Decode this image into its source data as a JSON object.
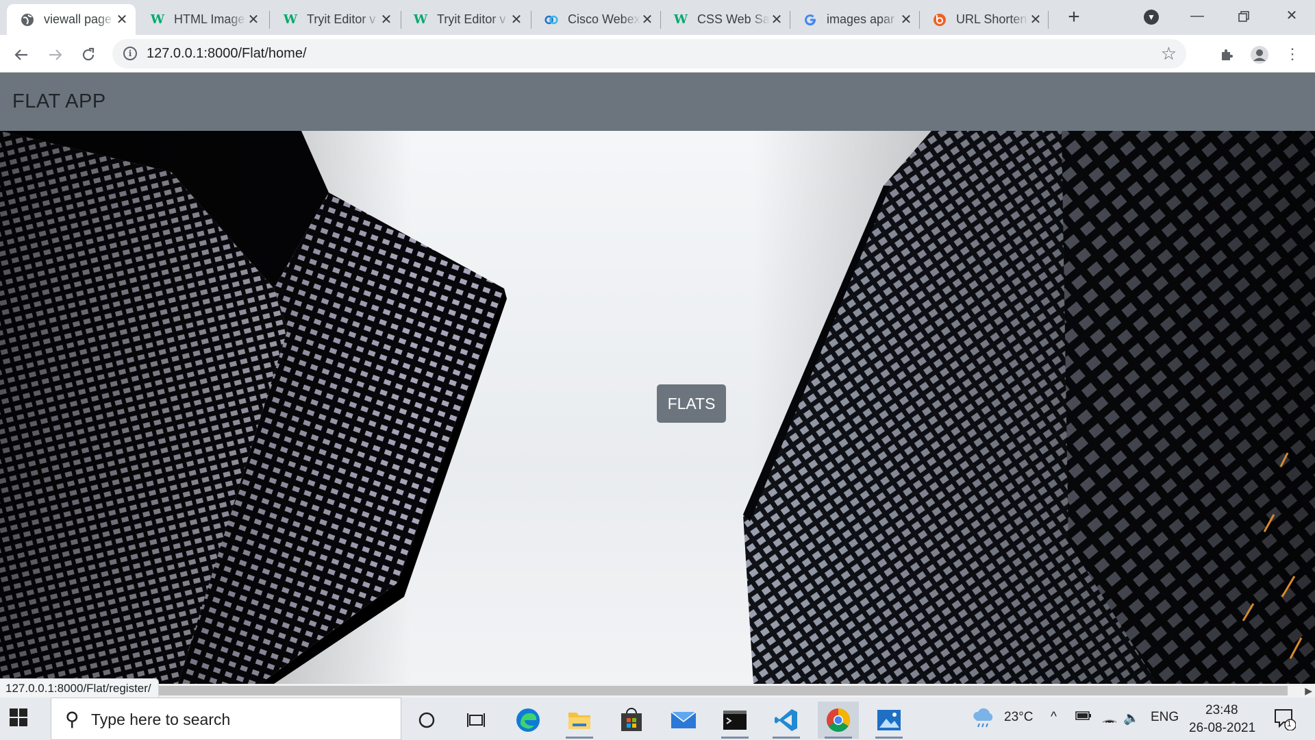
{
  "browser": {
    "tabs": [
      {
        "title": "viewall page",
        "icon": "globe-icon",
        "active": true
      },
      {
        "title": "HTML Image",
        "icon": "w3schools-icon",
        "active": false
      },
      {
        "title": "Tryit Editor v",
        "icon": "w3schools-icon",
        "active": false
      },
      {
        "title": "Tryit Editor v",
        "icon": "w3schools-icon",
        "active": false
      },
      {
        "title": "Cisco Webex",
        "icon": "webex-icon",
        "active": false
      },
      {
        "title": "CSS Web Sa",
        "icon": "w3schools-icon",
        "active": false
      },
      {
        "title": "images apar",
        "icon": "google-icon",
        "active": false
      },
      {
        "title": "URL Shorten",
        "icon": "bitly-icon",
        "active": false
      }
    ],
    "url_host": "127.0.0.1",
    "url_path": ":8000/Flat/home/",
    "status_url": "127.0.0.1:8000/Flat/register/"
  },
  "page": {
    "brand": "FLAT APP",
    "flats_button": "FLATS"
  },
  "taskbar": {
    "search_placeholder": "Type here to search",
    "weather": "23°C",
    "language": "ENG",
    "time": "23:48",
    "date": "26-08-2021",
    "notification_count": "1"
  }
}
